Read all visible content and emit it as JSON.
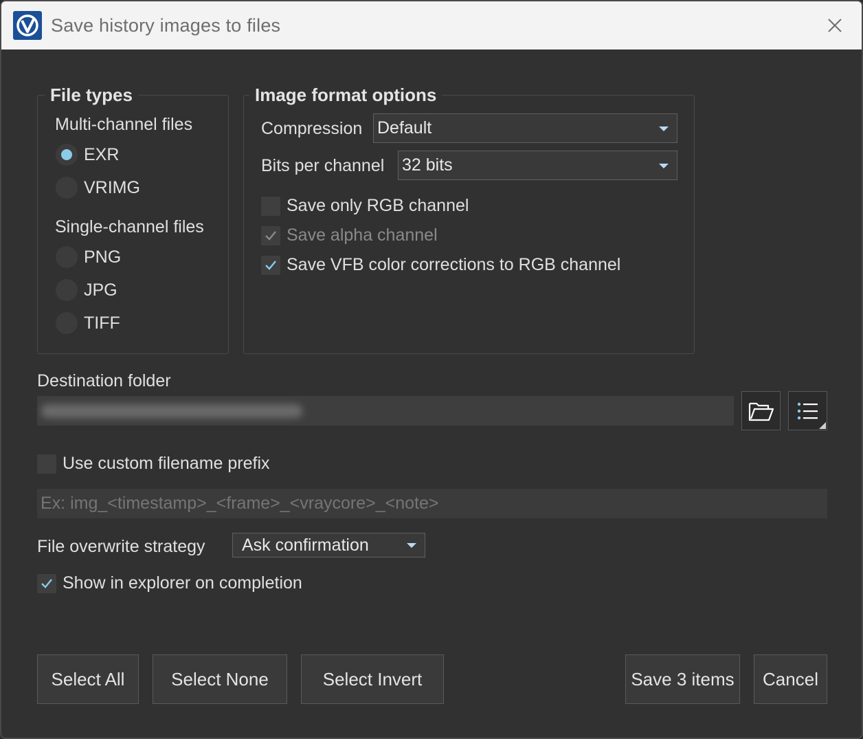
{
  "window": {
    "title": "Save history images to files",
    "accent_color": "#1b4f96"
  },
  "file_types": {
    "title": "File types",
    "multi_label": "Multi-channel files",
    "single_label": "Single-channel files",
    "options": {
      "exr": "EXR",
      "vrimg": "VRIMG",
      "png": "PNG",
      "jpg": "JPG",
      "tiff": "TIFF"
    },
    "selected": "EXR"
  },
  "image_format": {
    "title": "Image format options",
    "compression_label": "Compression",
    "compression_value": "Default",
    "bits_label": "Bits per channel",
    "bits_value": "32 bits",
    "save_rgb_only": {
      "label": "Save only RGB channel",
      "checked": false
    },
    "save_alpha": {
      "label": "Save alpha channel",
      "checked": true,
      "disabled": true
    },
    "save_vfb": {
      "label": "Save VFB color corrections to RGB channel",
      "checked": true
    }
  },
  "destination": {
    "label": "Destination folder",
    "path_obscured": true
  },
  "prefix": {
    "checkbox_label": "Use custom filename prefix",
    "checked": false,
    "placeholder": "Ex: img_<timestamp>_<frame>_<vraycore>_<note>"
  },
  "overwrite": {
    "label": "File overwrite strategy",
    "value": "Ask confirmation"
  },
  "show_explorer": {
    "label": "Show in explorer on completion",
    "checked": true
  },
  "buttons": {
    "select_all": "Select All",
    "select_none": "Select None",
    "select_invert": "Select Invert",
    "save": "Save 3 items",
    "cancel": "Cancel"
  }
}
